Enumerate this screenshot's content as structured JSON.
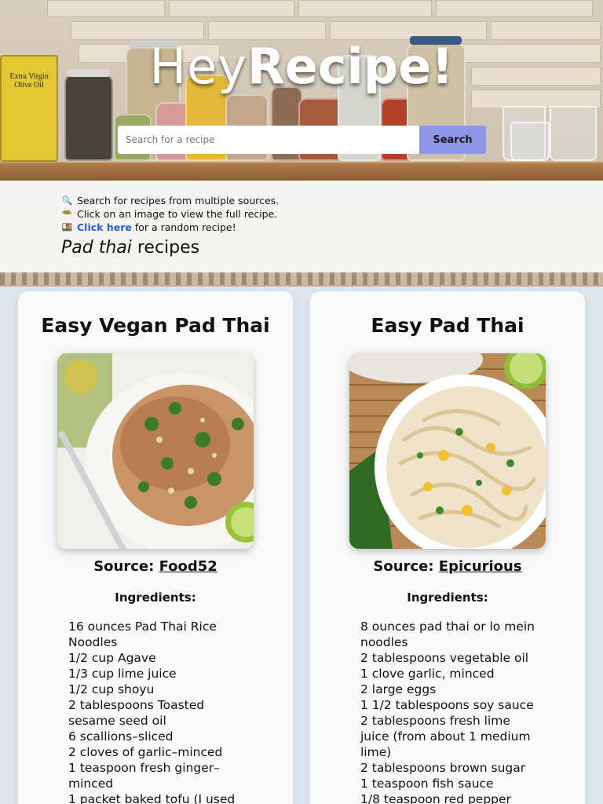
{
  "brand": {
    "part1": "Hey",
    "part2": "Recipe!"
  },
  "hero": {
    "oil_label": "Extra Virgin Olive Oil"
  },
  "search": {
    "placeholder": "Search for a recipe",
    "button": "Search"
  },
  "info": {
    "line1": "Search for recipes from multiple sources.",
    "line2": "Click on an image to view the full recipe.",
    "line3_link": "Click here",
    "line3_rest": " for a random recipe!",
    "icons": [
      "magnifier-icon",
      "salad-bowl-icon",
      "bento-icon"
    ]
  },
  "heading": {
    "query": "Pad thai",
    "suffix": " recipes"
  },
  "labels": {
    "source": "Source: ",
    "ingredients": "Ingredients:"
  },
  "recipes": [
    {
      "title": "Easy Vegan Pad Thai",
      "source": "Food52",
      "ingredients": [
        "16 ounces Pad Thai Rice Noodles",
        "1/2 cup Agave",
        "1/3 cup lime juice",
        "1/2 cup shoyu",
        "2 tablespoons Toasted sesame seed oil",
        "6 scallions–sliced",
        "2 cloves of garlic–minced",
        "1 teaspoon fresh ginger–minced",
        "1 packet baked tofu (I used"
      ]
    },
    {
      "title": "Easy Pad Thai",
      "source": "Epicurious",
      "ingredients": [
        "8 ounces pad thai or lo mein noodles",
        "2 tablespoons vegetable oil",
        "1 clove garlic, minced",
        "2 large eggs",
        "1 1/2 tablespoons soy sauce",
        "2 tablespoons fresh lime juice (from about 1 medium lime)",
        "2 tablespoons brown sugar",
        "1 teaspoon fish sauce",
        "1/8 teaspoon red pepper"
      ]
    }
  ],
  "colors": {
    "search_button": "#8f96e8",
    "link": "#2a5bd7",
    "card_bg": "#f8f9fb",
    "page_bg": "#dfe5ec"
  }
}
